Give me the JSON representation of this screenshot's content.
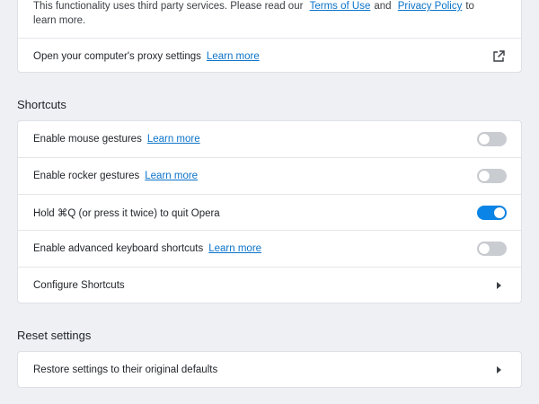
{
  "privacy_card": {
    "note_text": "This functionality uses third party services. Please read our",
    "terms_link": "Terms of Use",
    "and_text": "and",
    "privacy_link": "Privacy Policy",
    "note_tail": "to",
    "note_tail2": "learn more.",
    "proxy_label": "Open your computer's proxy settings",
    "proxy_link": "Learn more",
    "proxy_icon": "external-link-icon"
  },
  "shortcuts": {
    "title": "Shortcuts",
    "rows": [
      {
        "label": "Enable mouse gestures",
        "link": "Learn more",
        "toggle": false
      },
      {
        "label": "Enable rocker gestures",
        "link": "Learn more",
        "toggle": false
      },
      {
        "label": "Hold ⌘Q (or press it twice) to quit Opera",
        "toggle": true
      },
      {
        "label": "Enable advanced keyboard shortcuts",
        "link": "Learn more",
        "toggle": false
      },
      {
        "label": "Configure Shortcuts"
      }
    ]
  },
  "reset": {
    "title": "Reset settings",
    "restore_label": "Restore settings to their original defaults"
  },
  "colors": {
    "toggle_on": "#0a84e6",
    "toggle_off": "#c9ccd1",
    "link": "#0b73c9",
    "background": "#eef0f4"
  }
}
